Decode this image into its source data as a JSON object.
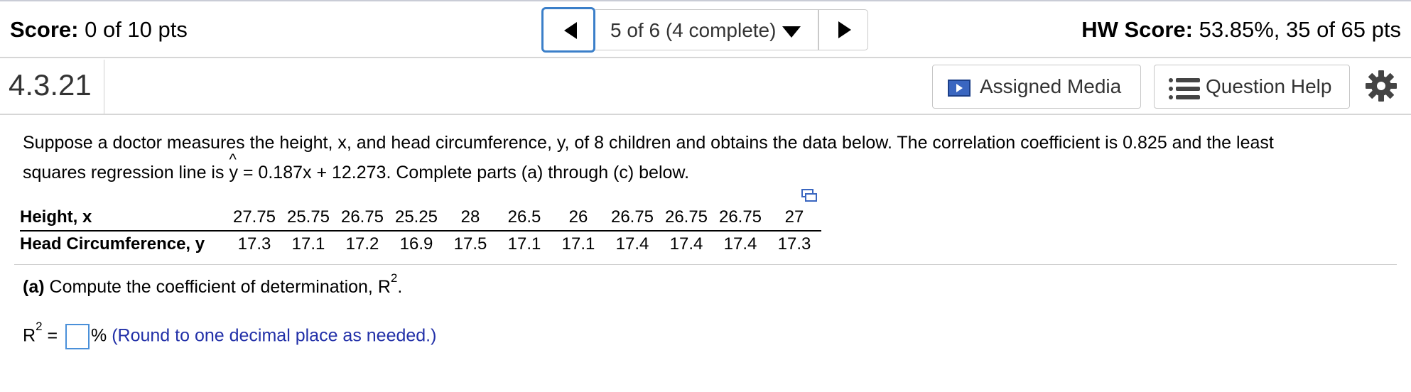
{
  "header": {
    "score_label": "Score:",
    "score_value": "0 of 10 pts",
    "hw_label": "HW Score:",
    "hw_value": "53.85%, 35 of 65 pts",
    "progress": "5 of 6 (4 complete)"
  },
  "question": {
    "number": "4.3.21",
    "assigned_media": "Assigned Media",
    "question_help": "Question Help"
  },
  "problem": {
    "line1": "Suppose a doctor measures the height, x, and head circumference, y, of 8 children and obtains the data below. The correlation coefficient is 0.825 and the least",
    "line2_prefix": "squares regression line is",
    "yhat": "y",
    "line2_suffix": "= 0.187x + 12.273. Complete parts (a) through (c) below."
  },
  "table": {
    "row_labels": [
      "Height, x",
      "Head Circumference, y"
    ],
    "x": [
      "27.75",
      "25.75",
      "26.75",
      "25.25",
      "28",
      "26.5",
      "26",
      "26.75",
      "26.75",
      "26.75",
      "27"
    ],
    "y": [
      "17.3",
      "17.1",
      "17.2",
      "16.9",
      "17.5",
      "17.1",
      "17.1",
      "17.4",
      "17.4",
      "17.4",
      "17.3"
    ]
  },
  "part_a": {
    "label": "(a)",
    "text": "Compute the coefficient of determination, R",
    "sup": "2",
    "end": ".",
    "answer_prefix": "R",
    "answer_sup": "2",
    "answer_eq": " =",
    "answer_unit": "%",
    "hint": "(Round to one decimal place as needed.)"
  }
}
